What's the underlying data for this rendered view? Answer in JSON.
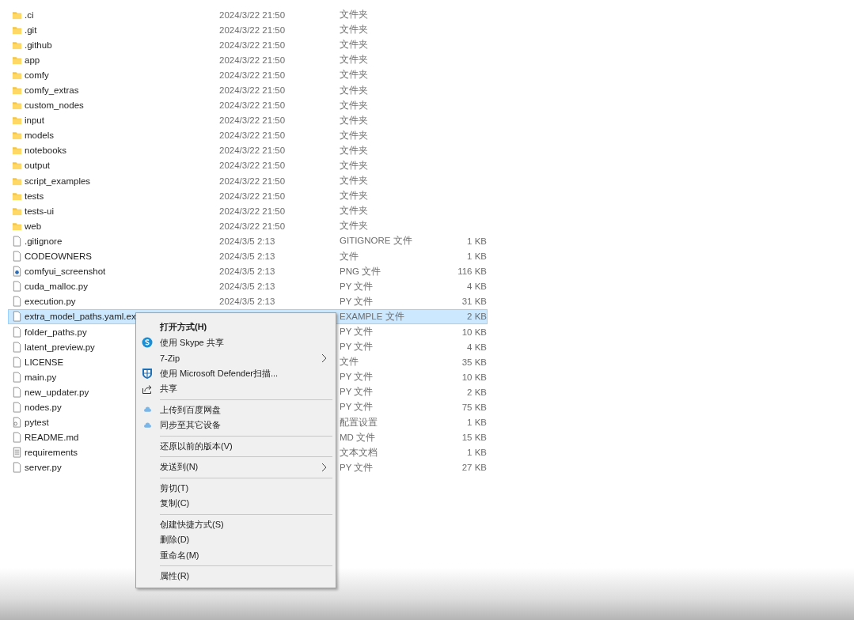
{
  "files": [
    {
      "kind": "folder",
      "name": ".ci",
      "date": "2024/3/22 21:50",
      "type": "文件夹",
      "selected": false
    },
    {
      "kind": "folder",
      "name": ".git",
      "date": "2024/3/22 21:50",
      "type": "文件夹",
      "selected": false
    },
    {
      "kind": "folder",
      "name": ".github",
      "date": "2024/3/22 21:50",
      "type": "文件夹",
      "selected": false
    },
    {
      "kind": "folder",
      "name": "app",
      "date": "2024/3/22 21:50",
      "type": "文件夹",
      "selected": false
    },
    {
      "kind": "folder",
      "name": "comfy",
      "date": "2024/3/22 21:50",
      "type": "文件夹",
      "selected": false
    },
    {
      "kind": "folder",
      "name": "comfy_extras",
      "date": "2024/3/22 21:50",
      "type": "文件夹",
      "selected": false
    },
    {
      "kind": "folder",
      "name": "custom_nodes",
      "date": "2024/3/22 21:50",
      "type": "文件夹",
      "selected": false
    },
    {
      "kind": "folder",
      "name": "input",
      "date": "2024/3/22 21:50",
      "type": "文件夹",
      "selected": false
    },
    {
      "kind": "folder",
      "name": "models",
      "date": "2024/3/22 21:50",
      "type": "文件夹",
      "selected": false
    },
    {
      "kind": "folder",
      "name": "notebooks",
      "date": "2024/3/22 21:50",
      "type": "文件夹",
      "selected": false
    },
    {
      "kind": "folder",
      "name": "output",
      "date": "2024/3/22 21:50",
      "type": "文件夹",
      "selected": false
    },
    {
      "kind": "folder",
      "name": "script_examples",
      "date": "2024/3/22 21:50",
      "type": "文件夹",
      "selected": false
    },
    {
      "kind": "folder",
      "name": "tests",
      "date": "2024/3/22 21:50",
      "type": "文件夹",
      "selected": false
    },
    {
      "kind": "folder",
      "name": "tests-ui",
      "date": "2024/3/22 21:50",
      "type": "文件夹",
      "selected": false
    },
    {
      "kind": "folder",
      "name": "web",
      "date": "2024/3/22 21:50",
      "type": "文件夹",
      "selected": false
    },
    {
      "kind": "file",
      "name": ".gitignore",
      "date": "2024/3/5 2:13",
      "type": "GITIGNORE 文件",
      "size": "1 KB",
      "selected": false
    },
    {
      "kind": "file",
      "name": "CODEOWNERS",
      "date": "2024/3/5 2:13",
      "type": "文件",
      "size": "1 KB",
      "selected": false
    },
    {
      "kind": "image",
      "name": "comfyui_screenshot",
      "date": "2024/3/5 2:13",
      "type": "PNG 文件",
      "size": "116 KB",
      "selected": false
    },
    {
      "kind": "file",
      "name": "cuda_malloc.py",
      "date": "2024/3/5 2:13",
      "type": "PY 文件",
      "size": "4 KB",
      "selected": false
    },
    {
      "kind": "file",
      "name": "execution.py",
      "date": "2024/3/5 2:13",
      "type": "PY 文件",
      "size": "31 KB",
      "selected": false
    },
    {
      "kind": "file",
      "name": "extra_model_paths.yaml.ex",
      "type": "EXAMPLE 文件",
      "size": "2 KB",
      "selected": true
    },
    {
      "kind": "file",
      "name": "folder_paths.py",
      "type": "PY 文件",
      "size": "10 KB",
      "selected": false
    },
    {
      "kind": "file",
      "name": "latent_preview.py",
      "type": "PY 文件",
      "size": "4 KB",
      "selected": false
    },
    {
      "kind": "file",
      "name": "LICENSE",
      "type": "文件",
      "size": "35 KB",
      "selected": false
    },
    {
      "kind": "file",
      "name": "main.py",
      "type": "PY 文件",
      "size": "10 KB",
      "selected": false
    },
    {
      "kind": "file",
      "name": "new_updater.py",
      "type": "PY 文件",
      "size": "2 KB",
      "selected": false
    },
    {
      "kind": "file",
      "name": "nodes.py",
      "type": "PY 文件",
      "size": "75 KB",
      "selected": false
    },
    {
      "kind": "config",
      "name": "pytest",
      "type": "配置设置",
      "size": "1 KB",
      "selected": false
    },
    {
      "kind": "file",
      "name": "README.md",
      "type": "MD 文件",
      "size": "15 KB",
      "selected": false
    },
    {
      "kind": "text",
      "name": "requirements",
      "type": "文本文档",
      "size": "1 KB",
      "selected": false
    },
    {
      "kind": "file",
      "name": "server.py",
      "type": "PY 文件",
      "size": "27 KB",
      "selected": false
    }
  ],
  "context_menu": {
    "items": [
      {
        "kind": "item",
        "label": "打开方式(H)",
        "default": true
      },
      {
        "kind": "item",
        "label": "使用 Skype 共享",
        "default": false
      },
      {
        "kind": "submenu",
        "label": "7-Zip",
        "default": false
      },
      {
        "kind": "item",
        "label": "使用 Microsoft Defender扫描...",
        "default": false
      },
      {
        "kind": "item",
        "label": "共享",
        "default": false
      },
      {
        "kind": "separator"
      },
      {
        "kind": "item",
        "label": "上传到百度网盘",
        "default": false
      },
      {
        "kind": "item",
        "label": "同步至其它设备",
        "default": false
      },
      {
        "kind": "separator"
      },
      {
        "kind": "item",
        "label": "还原以前的版本(V)",
        "default": false
      },
      {
        "kind": "separator"
      },
      {
        "kind": "submenu",
        "label": "发送到(N)",
        "default": false
      },
      {
        "kind": "separator"
      },
      {
        "kind": "item",
        "label": "剪切(T)",
        "default": false
      },
      {
        "kind": "item",
        "label": "复制(C)",
        "default": false
      },
      {
        "kind": "separator"
      },
      {
        "kind": "item",
        "label": "创建快捷方式(S)",
        "default": false
      },
      {
        "kind": "item",
        "label": "删除(D)",
        "default": false
      },
      {
        "kind": "item",
        "label": "重命名(M)",
        "default": false
      },
      {
        "kind": "separator"
      },
      {
        "kind": "item",
        "label": "属性(R)",
        "default": false
      }
    ]
  }
}
